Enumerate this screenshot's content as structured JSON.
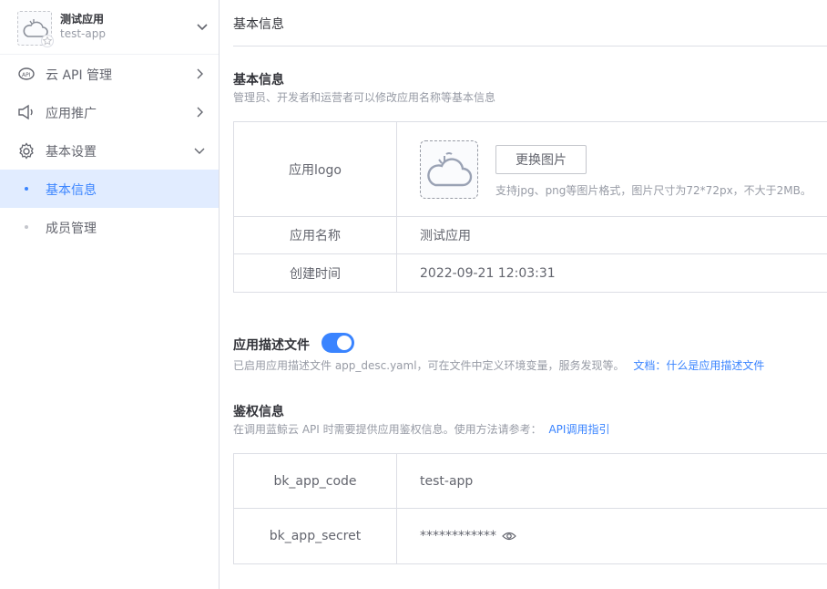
{
  "app": {
    "name": "测试应用",
    "code": "test-app"
  },
  "nav": {
    "items": [
      {
        "label": "云 API 管理",
        "icon": "api-icon"
      },
      {
        "label": "应用推广",
        "icon": "speaker-icon"
      },
      {
        "label": "基本设置",
        "icon": "gear-icon"
      }
    ],
    "sub_items": [
      {
        "label": "基本信息",
        "active": true
      },
      {
        "label": "成员管理",
        "active": false
      }
    ]
  },
  "breadcrumb": "基本信息",
  "basic": {
    "title": "基本信息",
    "desc": "管理员、开发者和运营者可以修改应用名称等基本信息",
    "rows": {
      "logo_label": "应用logo",
      "change_btn": "更换图片",
      "logo_tip": "支持jpg、png等图片格式，图片尺寸为72*72px，不大于2MB。",
      "name_label": "应用名称",
      "name_value": "测试应用",
      "created_label": "创建时间",
      "created_value": "2022-09-21 12:03:31"
    }
  },
  "desc_file": {
    "title": "应用描述文件",
    "enabled": true,
    "desc": "已启用应用描述文件 app_desc.yaml，可在文件中定义环境变量，服务发现等。",
    "link": "文档：什么是应用描述文件"
  },
  "auth": {
    "title": "鉴权信息",
    "desc": "在调用蓝鲸云 API 时需要提供应用鉴权信息。使用方法请参考：",
    "link": "API调用指引",
    "code_label": "bk_app_code",
    "code_value": "test-app",
    "secret_label": "bk_app_secret",
    "secret_value": "************"
  },
  "colors": {
    "primary": "#3a84ff",
    "active_bg": "#e1ecff",
    "border": "#dcdee5",
    "muted": "#979ba5"
  }
}
